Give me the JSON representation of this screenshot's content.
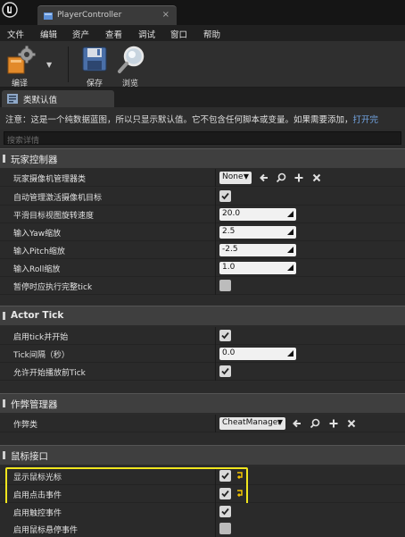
{
  "window": {
    "tab_title": "PlayerController"
  },
  "menu": [
    "文件",
    "编辑",
    "资产",
    "查看",
    "调试",
    "窗口",
    "帮助"
  ],
  "toolbar": {
    "compile_label": "编译",
    "save_label": "保存",
    "browse_label": "浏览"
  },
  "panel": {
    "tab_label": "类默认值"
  },
  "notice": {
    "text": "注意：这是一个纯数据蓝图，所以只显示默认值。它不包含任何脚本或变量。如果需要添加，",
    "link": "打开完"
  },
  "search": {
    "placeholder": "搜索详情"
  },
  "sections": {
    "player_controller": {
      "title": "玩家控制器",
      "camera_manager_label": "玩家摄像机管理器类",
      "camera_manager_value": "None",
      "auto_activate_label": "自动管理激活摄像机目标",
      "auto_activate_checked": true,
      "smooth_rot_label": "平滑目标视图旋转速度",
      "smooth_rot_value": "20.0",
      "yaw_label": "输入Yaw缩放",
      "yaw_value": "2.5",
      "pitch_label": "输入Pitch缩放",
      "pitch_value": "-2.5",
      "roll_label": "输入Roll缩放",
      "roll_value": "1.0",
      "pause_tick_label": "暂停时应执行完整tick",
      "pause_tick_checked": false
    },
    "actor_tick": {
      "title": "Actor Tick",
      "start_tick_label": "启用tick并开始",
      "start_tick_checked": true,
      "interval_label": "Tick间隔（秒）",
      "interval_value": "0.0",
      "before_play_label": "允许开始播放前Tick",
      "before_play_checked": true
    },
    "cheat_manager": {
      "title": "作弊管理器",
      "class_label": "作弊类",
      "class_value": "CheatManager"
    },
    "mouse": {
      "title": "鼠标接口",
      "show_cursor_label": "显示鼠标光标",
      "show_cursor_checked": true,
      "click_events_label": "启用点击事件",
      "click_events_checked": true,
      "touch_events_label": "启用触控事件",
      "touch_events_checked": true,
      "hover_events_label": "启用鼠标悬停事件",
      "hover_events_checked": false
    }
  },
  "colors": {
    "highlight": "#f0e61e",
    "link": "#74a7e6",
    "reset_arrow": "#f5c400"
  }
}
